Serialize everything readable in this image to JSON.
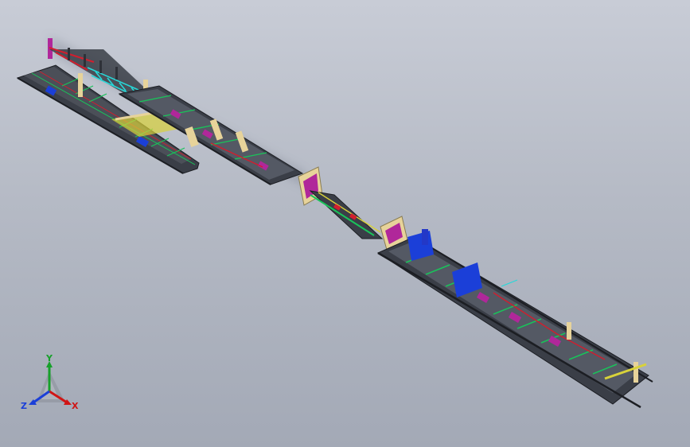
{
  "view": {
    "background_top": "#c8ccd6",
    "background_bottom": "#a3a9b6"
  },
  "model": {
    "colors": {
      "frame": "#2e3138",
      "green": "#19c35a",
      "red": "#d11e2e",
      "blue": "#1b3fd8",
      "magenta": "#b0279a",
      "purple": "#7a3fb5",
      "tan": "#e7d39a",
      "cyan": "#27d8d8",
      "yellow": "#d8d23a"
    }
  },
  "triad": {
    "x_label": "X",
    "y_label": "Y",
    "z_label": "Z",
    "x_color": "#d01515",
    "y_color": "#16a02a",
    "z_color": "#1b3fd8"
  }
}
